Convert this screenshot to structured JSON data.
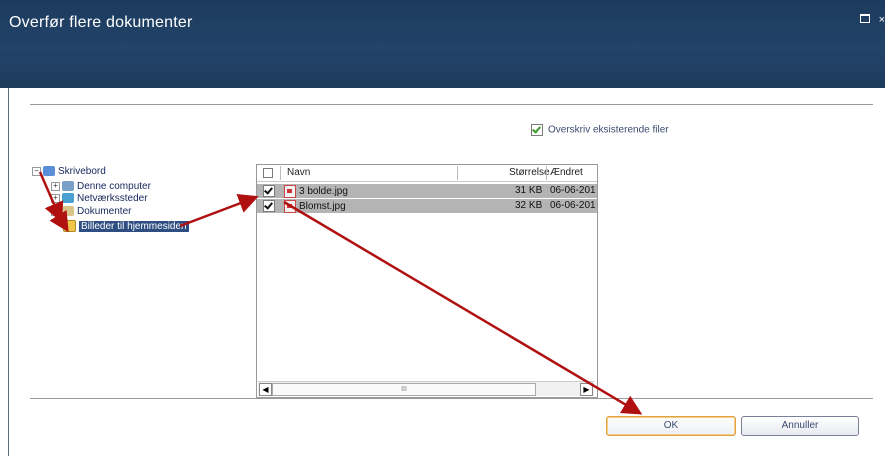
{
  "dialog": {
    "title": "Overfør flere dokumenter"
  },
  "options": {
    "overwrite_label": "Overskriv eksisterende filer",
    "overwrite_checked": true
  },
  "tree": {
    "root": "Skrivebord",
    "items": [
      "Denne computer",
      "Netværkssteder",
      "Dokumenter",
      "Billeder til hjemmesiden"
    ],
    "selected": "Billeder til hjemmesiden"
  },
  "file_list": {
    "columns": {
      "name": "Navn",
      "size": "Størrelse",
      "modified": "Ændret"
    },
    "rows": [
      {
        "name": "3 bolde.jpg",
        "size": "31 KB",
        "modified": "06-06-201",
        "checked": true
      },
      {
        "name": "Blomst.jpg",
        "size": "32 KB",
        "modified": "06-06-201",
        "checked": true
      }
    ],
    "scroll_thumb": "III"
  },
  "buttons": {
    "ok": "OK",
    "cancel": "Annuller"
  },
  "colors": {
    "title_bar": "#22446a",
    "annotation_arrow": "#b01010",
    "selection": "#2e4d80"
  }
}
